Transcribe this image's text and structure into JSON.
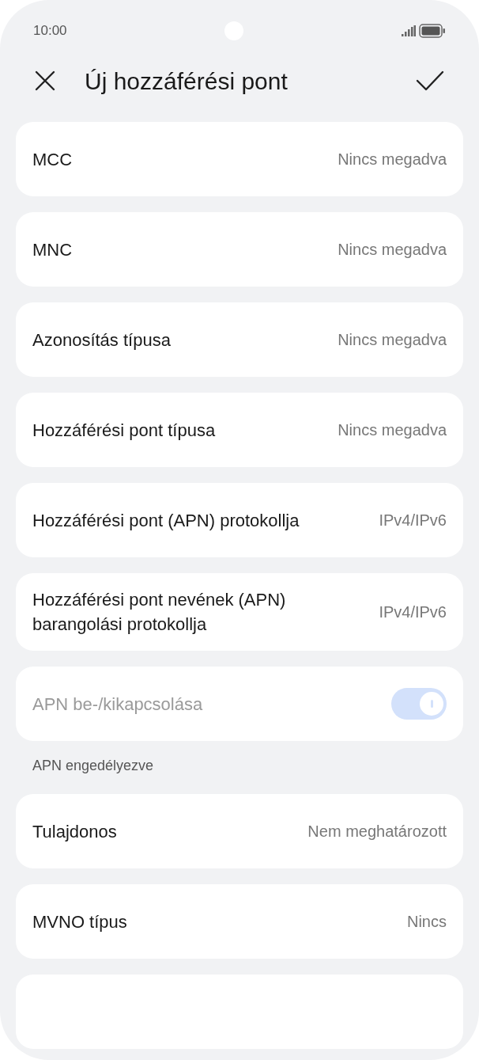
{
  "status_bar": {
    "time": "10:00"
  },
  "header": {
    "title": "Új hozzáférési pont"
  },
  "items": [
    {
      "kind": "value",
      "label": "MCC",
      "value": "Nincs megadva"
    },
    {
      "kind": "value",
      "label": "MNC",
      "value": "Nincs megadva"
    },
    {
      "kind": "value",
      "label": "Azonosítás típusa",
      "value": "Nincs megadva"
    },
    {
      "kind": "value",
      "label": "Hozzáférési pont típusa",
      "value": "Nincs megadva"
    },
    {
      "kind": "value",
      "label": "Hozzáférési pont (APN) protokollja",
      "value": "IPv4/IPv6"
    },
    {
      "kind": "value",
      "label": "Hozzáférési pont nevének (APN) barangolási protokollja",
      "value": "IPv4/IPv6"
    },
    {
      "kind": "toggle",
      "label": "APN be-/kikapcsolása",
      "on": true,
      "disabled": true
    },
    {
      "kind": "caption",
      "label": "APN engedélyezve"
    },
    {
      "kind": "value",
      "label": "Tulajdonos",
      "value": "Nem meghatározott"
    },
    {
      "kind": "value",
      "label": "MVNO típus",
      "value": "Nincs"
    }
  ]
}
